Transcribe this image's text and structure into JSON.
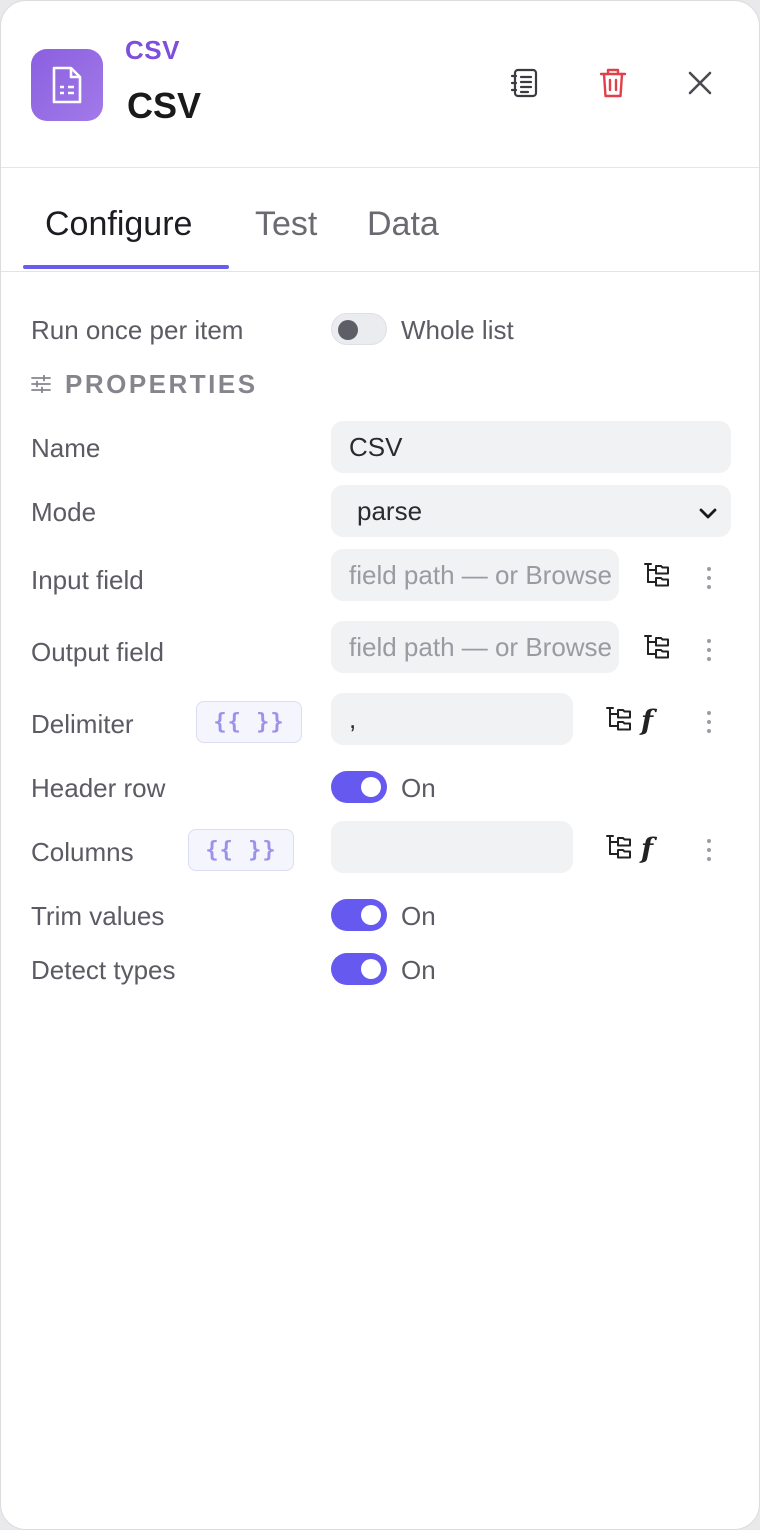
{
  "header": {
    "node_type": "CSV",
    "title": "CSV",
    "icons": [
      "file-spreadsheet-icon",
      "notes-icon",
      "trash-icon",
      "close-icon"
    ]
  },
  "tabs": [
    {
      "label": "Configure",
      "active": true
    },
    {
      "label": "Test",
      "active": false
    },
    {
      "label": "Data",
      "active": false
    }
  ],
  "run_mode": {
    "label": "Run once per item",
    "toggle_text": "Whole list",
    "on": false
  },
  "section_title": "PROPERTIES",
  "fields": {
    "name": {
      "label": "Name",
      "value": "CSV"
    },
    "mode": {
      "label": "Mode",
      "value": "parse"
    },
    "input_field": {
      "label": "Input field",
      "placeholder": "field path — or Browse"
    },
    "output_field": {
      "label": "Output field",
      "placeholder": "field path — or Browse"
    },
    "delimiter": {
      "label": "Delimiter",
      "expr_chip": "{{ }}",
      "value": ","
    },
    "header_row": {
      "label": "Header row",
      "toggle_text": "On",
      "on": true
    },
    "columns": {
      "label": "Columns",
      "expr_chip": "{{ }}",
      "value": ""
    },
    "trim_values": {
      "label": "Trim values",
      "toggle_text": "On",
      "on": true
    },
    "detect_types": {
      "label": "Detect types",
      "toggle_text": "On",
      "on": true
    }
  },
  "fx_label": "f",
  "colors": {
    "accent": "#6659ef",
    "brand": "#8b5fe0",
    "danger": "#e0404a"
  }
}
